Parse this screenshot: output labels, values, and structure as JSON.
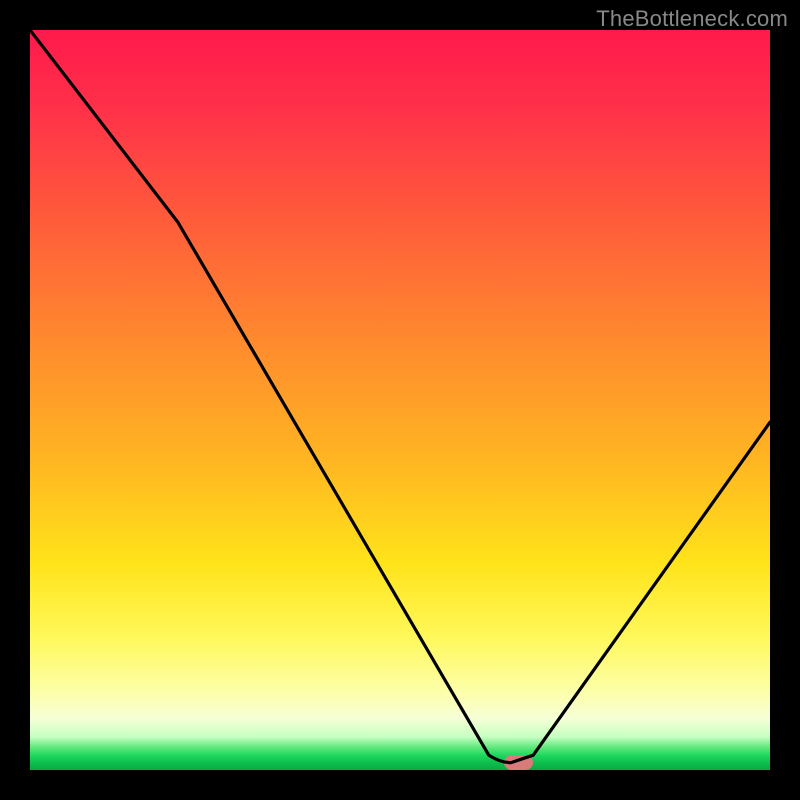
{
  "watermark": "TheBottleneck.com",
  "chart_data": {
    "type": "line",
    "title": "",
    "xlabel": "",
    "ylabel": "",
    "xlim": [
      0,
      100
    ],
    "ylim": [
      0,
      100
    ],
    "grid": false,
    "legend": false,
    "series": [
      {
        "name": "curve",
        "x": [
          0,
          20,
          62,
          65,
          68,
          100
        ],
        "values": [
          100,
          74,
          2,
          1,
          2,
          47
        ]
      }
    ],
    "optimal_point": {
      "x": 66,
      "y": 1
    },
    "marker": {
      "x": 66,
      "y": 1,
      "width_pct": 4,
      "height_pct": 2
    }
  },
  "colors": {
    "background": "#000000",
    "curve": "#000000",
    "marker": "#d97b7b",
    "gradient_top": "#ff1a4b",
    "gradient_bottom": "#0aa843"
  }
}
